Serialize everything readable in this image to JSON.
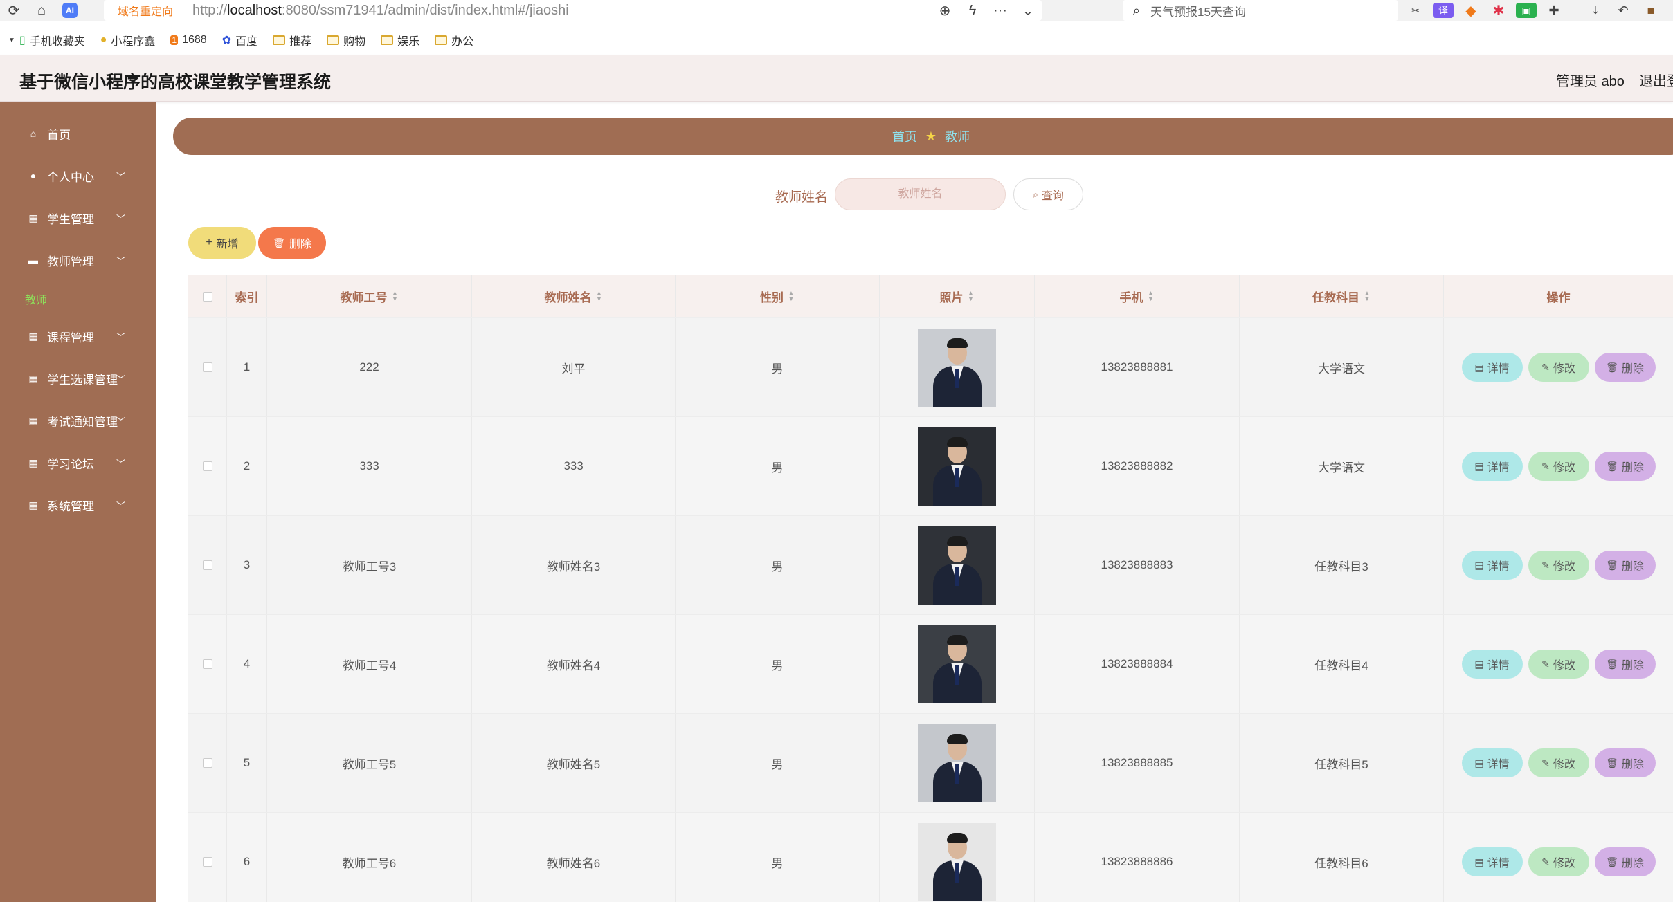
{
  "browser": {
    "redirect_tag": "域名重定向",
    "url_host": "localhost",
    "url_prefix": "http://",
    "url_rest": ":8080/ssm71941/admin/dist/index.html#/jiaoshi",
    "search_text": "天气预报15天查询"
  },
  "bookmarks": [
    {
      "label": "手机收藏夹"
    },
    {
      "label": "小程序鑫"
    },
    {
      "label": "1688"
    },
    {
      "label": "百度"
    },
    {
      "label": "推荐"
    },
    {
      "label": "购物"
    },
    {
      "label": "娱乐"
    },
    {
      "label": "办公"
    }
  ],
  "header": {
    "title": "基于微信小程序的高校课堂教学管理系统",
    "admin": "管理员 abo",
    "logout": "退出登录"
  },
  "sidebar": {
    "items": [
      {
        "label": "首页"
      },
      {
        "label": "个人中心"
      },
      {
        "label": "学生管理"
      },
      {
        "label": "教师管理"
      },
      {
        "label": "课程管理"
      },
      {
        "label": "学生选课管理"
      },
      {
        "label": "考试通知管理"
      },
      {
        "label": "学习论坛"
      },
      {
        "label": "系统管理"
      }
    ],
    "sub_active": "教师"
  },
  "breadcrumb": {
    "home": "首页",
    "current": "教师"
  },
  "filter": {
    "label": "教师姓名",
    "placeholder": "教师姓名",
    "query": "查询"
  },
  "buttons": {
    "add": "新增",
    "delete": "删除"
  },
  "table": {
    "headers": {
      "index": "索引",
      "teacher_no": "教师工号",
      "teacher_name": "教师姓名",
      "gender": "性别",
      "photo": "照片",
      "phone": "手机",
      "subject": "任教科目",
      "actions": "操作"
    },
    "action_labels": {
      "detail": "详情",
      "edit": "修改",
      "delete": "删除"
    },
    "rows": [
      {
        "index": "1",
        "teacher_no": "222",
        "teacher_name": "刘平",
        "gender": "男",
        "phone": "13823888881",
        "subject": "大学语文"
      },
      {
        "index": "2",
        "teacher_no": "333",
        "teacher_name": "333",
        "gender": "男",
        "phone": "13823888882",
        "subject": "大学语文"
      },
      {
        "index": "3",
        "teacher_no": "教师工号3",
        "teacher_name": "教师姓名3",
        "gender": "男",
        "phone": "13823888883",
        "subject": "任教科目3"
      },
      {
        "index": "4",
        "teacher_no": "教师工号4",
        "teacher_name": "教师姓名4",
        "gender": "男",
        "phone": "13823888884",
        "subject": "任教科目4"
      },
      {
        "index": "5",
        "teacher_no": "教师工号5",
        "teacher_name": "教师姓名5",
        "gender": "男",
        "phone": "13823888885",
        "subject": "任教科目5"
      },
      {
        "index": "6",
        "teacher_no": "教师工号6",
        "teacher_name": "教师姓名6",
        "gender": "男",
        "phone": "13823888886",
        "subject": "任教科目6"
      }
    ]
  },
  "colors": {
    "sidebar": "#a06d53",
    "header_bg": "#f5eeed",
    "accent_text": "#a86b52",
    "add_btn": "#f1dc7a",
    "delete_btn": "#f4784b"
  }
}
